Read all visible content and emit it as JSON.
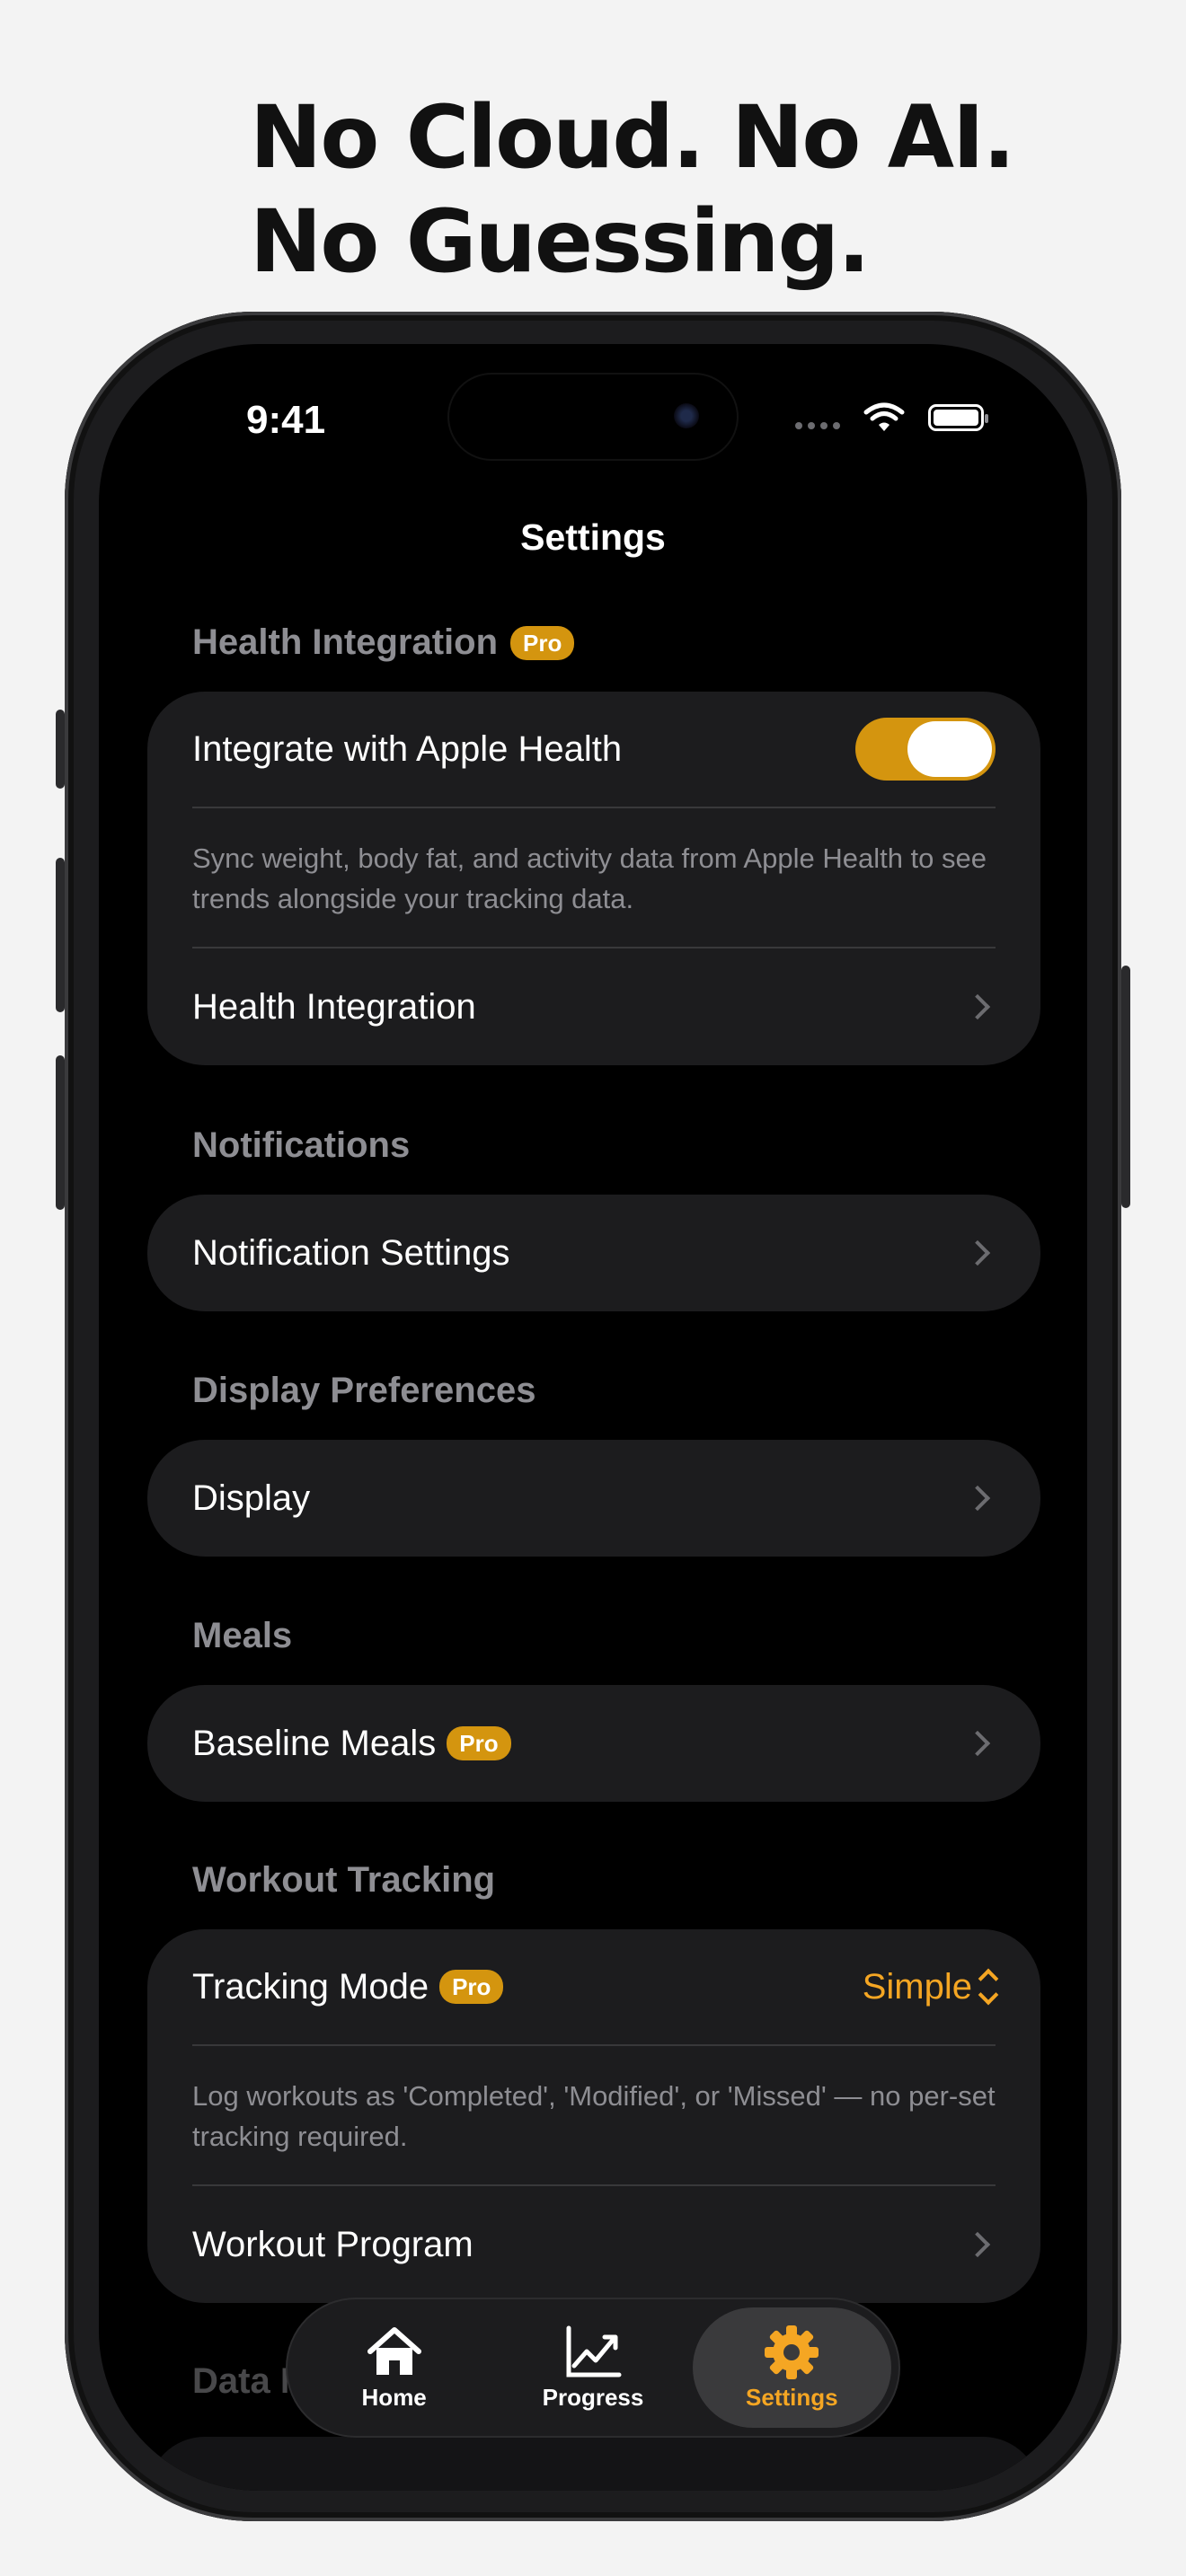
{
  "headline": {
    "line1": "No Cloud. No AI.",
    "line2": "No Guessing."
  },
  "status_bar": {
    "time": "9:41",
    "icons": [
      "signal-dots-icon",
      "wifi-icon",
      "battery-icon"
    ]
  },
  "nav": {
    "title": "Settings"
  },
  "pro_badge": "Pro",
  "accent_color": "#d4950f",
  "health": {
    "header": "Health Integration",
    "toggle_label": "Integrate with Apple Health",
    "toggle_on": true,
    "description": "Sync weight, body fat, and activity data from Apple Health to see trends alongside your tracking data.",
    "link_label": "Health Integration"
  },
  "notifications": {
    "header": "Notifications",
    "row_label": "Notification Settings"
  },
  "display": {
    "header": "Display Preferences",
    "row_label": "Display"
  },
  "meals": {
    "header": "Meals",
    "row_label": "Baseline Meals"
  },
  "workout": {
    "header": "Workout Tracking",
    "mode_label": "Tracking Mode",
    "mode_value": "Simple",
    "description": "Log workouts as 'Completed', 'Modified', or 'Missed' — no per-set tracking required.",
    "program_label": "Workout Program"
  },
  "data_management": {
    "header": "Data Management"
  },
  "tabbar": {
    "tabs": [
      {
        "label": "Home",
        "icon": "house-icon"
      },
      {
        "label": "Progress",
        "icon": "chart-icon"
      },
      {
        "label": "Settings",
        "icon": "gear-icon",
        "active": true
      }
    ]
  }
}
